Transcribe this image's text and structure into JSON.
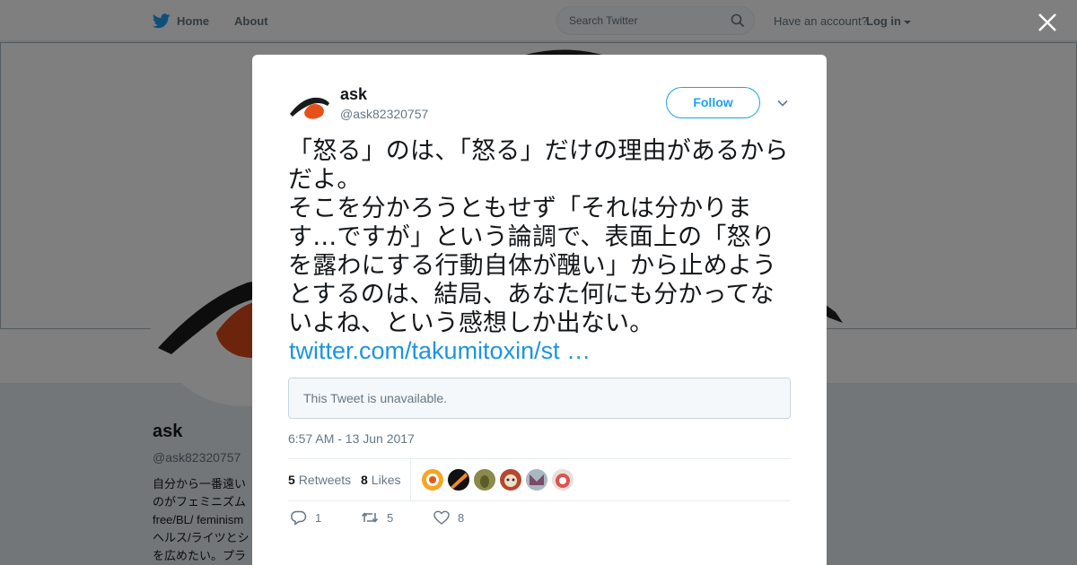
{
  "nav": {
    "home_label": "Home",
    "about_label": "About",
    "search_placeholder": "Search Twitter",
    "have_account": "Have an account?",
    "login_label": "Log in"
  },
  "profile": {
    "name": "ask",
    "handle": "@ask82320757",
    "bio_lines": [
      "自分から一番遠い",
      "のがフェミニズム",
      "free/BL/ feminism",
      "ヘルス/ライツとシ",
      "を広めたい。プラ"
    ]
  },
  "tweet": {
    "author_name": "ask",
    "author_handle": "@ask82320757",
    "follow_label": "Follow",
    "text": "「怒る」のは、「怒る」だけの理由があるからだよ。\nそこを分かろうともせず「それは分かります…ですが」という論調で、表面上の「怒りを露わにする行動自体が醜い」から止めようとするのは、結局、あなた何にも分かってないよね、という感想しか出ない。",
    "link": "twitter.com/takumitoxin/st …",
    "quote_unavailable": "This Tweet is unavailable.",
    "timestamp": "6:57 AM - 13 Jun 2017",
    "retweets_count": "5",
    "retweets_label": "Retweets",
    "likes_count": "8",
    "likes_label": "Likes",
    "replies": "1",
    "retweets_action": "5",
    "likes_action": "8"
  },
  "colors": {
    "accent": "#1da1f2",
    "link": "#1b95e0",
    "muted": "#657786",
    "avatar_orange": "#e8501a"
  },
  "likers": [
    {
      "name": "liker-1",
      "color": "#f5a623"
    },
    {
      "name": "liker-2",
      "color": "#111111"
    },
    {
      "name": "liker-3",
      "color": "#8a8a4a"
    },
    {
      "name": "liker-4",
      "color": "#b5472e"
    },
    {
      "name": "liker-5",
      "color": "#a8b8c0"
    },
    {
      "name": "liker-6",
      "color": "#e6e0d8"
    }
  ]
}
